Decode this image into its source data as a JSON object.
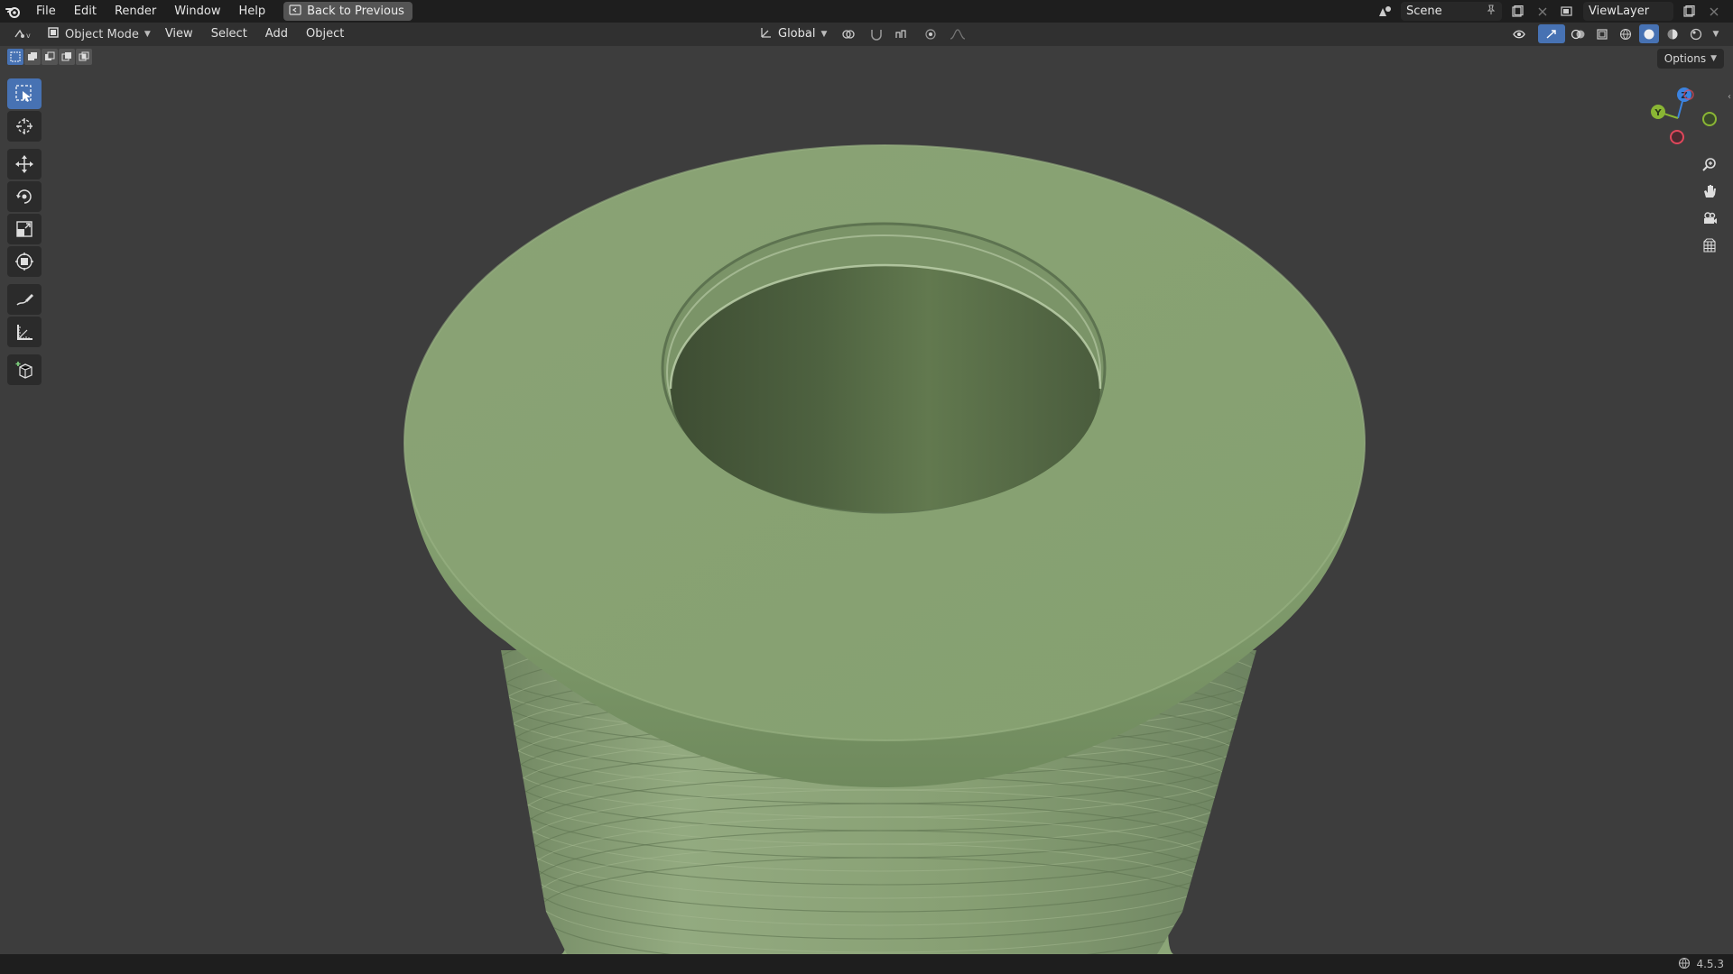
{
  "menubar": {
    "items": [
      "File",
      "Edit",
      "Render",
      "Window",
      "Help"
    ],
    "back_button": "Back to Previous",
    "scene_name": "Scene",
    "view_layer": "ViewLayer"
  },
  "viewport_header": {
    "mode": "Object Mode",
    "menus": [
      "View",
      "Select",
      "Add",
      "Object"
    ],
    "transform_orientation": "Global",
    "options_label": "Options"
  },
  "toolbar": {
    "tools": [
      "select-box",
      "cursor",
      "move",
      "rotate",
      "scale",
      "transform",
      "annotate",
      "measure",
      "add-cube"
    ],
    "active_tool": "select-box"
  },
  "gizmo": {
    "axes": [
      "X",
      "Y",
      "Z"
    ],
    "colors": {
      "x": "#e0475b",
      "y": "#8ab634",
      "z": "#3b83e0"
    }
  },
  "statusbar": {
    "version": "4.5.3"
  },
  "colors": {
    "viewport_bg": "#3d3d3d",
    "object_color": "#8aa074",
    "accent": "#4772b3"
  }
}
